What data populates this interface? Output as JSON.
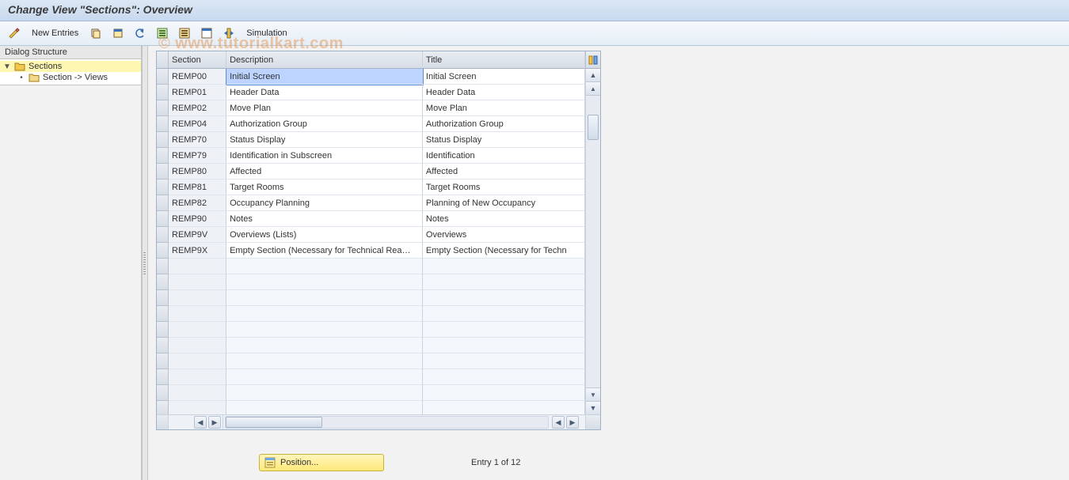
{
  "title": "Change View \"Sections\": Overview",
  "watermark": "© www.tutorialkart.com",
  "toolbar": {
    "new_entries": "New Entries",
    "simulation": "Simulation"
  },
  "left_panel": {
    "header": "Dialog Structure",
    "nodes": [
      {
        "label": "Sections",
        "level": 0,
        "open": true,
        "selected": true
      },
      {
        "label": "Section -> Views",
        "level": 1,
        "open": false,
        "selected": false
      }
    ]
  },
  "grid": {
    "columns": {
      "section": "Section",
      "description": "Description",
      "title": "Title"
    },
    "rows": [
      {
        "section": "REMP00",
        "desc": "Initial Screen",
        "title": "Initial Screen",
        "desc_selected": true
      },
      {
        "section": "REMP01",
        "desc": "Header Data",
        "title": "Header Data"
      },
      {
        "section": "REMP02",
        "desc": "Move Plan",
        "title": "Move Plan"
      },
      {
        "section": "REMP04",
        "desc": "Authorization Group",
        "title": "Authorization Group"
      },
      {
        "section": "REMP70",
        "desc": "Status Display",
        "title": "Status Display"
      },
      {
        "section": "REMP79",
        "desc": "Identification in Subscreen",
        "title": "Identification"
      },
      {
        "section": "REMP80",
        "desc": "Affected",
        "title": "Affected"
      },
      {
        "section": "REMP81",
        "desc": "Target Rooms",
        "title": "Target Rooms"
      },
      {
        "section": "REMP82",
        "desc": "Occupancy Planning",
        "title": "Planning of New Occupancy"
      },
      {
        "section": "REMP90",
        "desc": "Notes",
        "title": "Notes"
      },
      {
        "section": "REMP9V",
        "desc": "Overviews (Lists)",
        "title": "Overviews"
      },
      {
        "section": "REMP9X",
        "desc": "Empty Section (Necessary for Technical Rea…",
        "title": "Empty Section (Necessary for Techn"
      }
    ],
    "empty_rows": 10
  },
  "footer": {
    "position_btn": "Position...",
    "entry_text": "Entry 1 of 12"
  }
}
